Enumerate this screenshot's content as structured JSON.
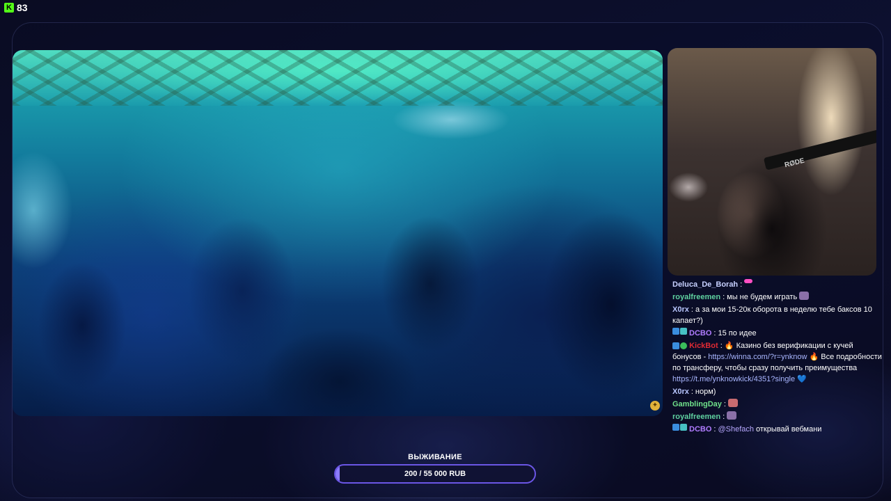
{
  "viewer": {
    "count": "83",
    "logo": "K"
  },
  "video": {
    "corner_icon": "badge-icon"
  },
  "webcam": {
    "mic_brand": "RØDE"
  },
  "chat": {
    "messages": [
      {
        "user": "Deluca_De_Borah",
        "color": "#c7d0ff",
        "badges": [],
        "text": "",
        "emote": "small"
      },
      {
        "user": "royalfreemen",
        "color": "#5fd1a0",
        "badges": [],
        "text": "мы не будем играть",
        "emote": "e3"
      },
      {
        "user": "X0rx",
        "color": "#b9c7ff",
        "badges": [],
        "text": "а за мои 15-20к оборота в неделю тебе баксов 10 капает?)"
      },
      {
        "user": "DCBO",
        "color": "#b07cff",
        "badges": [
          "b1",
          "b2"
        ],
        "text": "15 по идее"
      },
      {
        "user": "KickBot",
        "color": "#e02a34",
        "badges": [
          "b1",
          "b3"
        ],
        "part1": "Казино без верификации с кучей бонусов -",
        "link1": "https://winna.com/?r=ynknow",
        "part2": "Все подробности по трансферу, чтобы сразу получить преимущества",
        "link2": "https://t.me/ynknowkick/4351?single"
      },
      {
        "user": "X0rx",
        "color": "#b9c7ff",
        "badges": [],
        "text": "норм)"
      },
      {
        "user": "GamblingDay",
        "color": "#6fe08a",
        "badges": [],
        "text": "",
        "emote": "e4"
      },
      {
        "user": "royalfreemen",
        "color": "#5fd1a0",
        "badges": [],
        "text": "",
        "emote": "e3"
      },
      {
        "user": "DCBO",
        "color": "#b07cff",
        "badges": [
          "b1",
          "b2"
        ],
        "mention": "@Shefach",
        "text": "открывай вебмани"
      }
    ]
  },
  "survival": {
    "title": "ВЫЖИВАНИЕ",
    "progress_text": "200 / 55 000 RUB",
    "progress_fraction": 0.0036,
    "accent": "#6b56e6"
  }
}
